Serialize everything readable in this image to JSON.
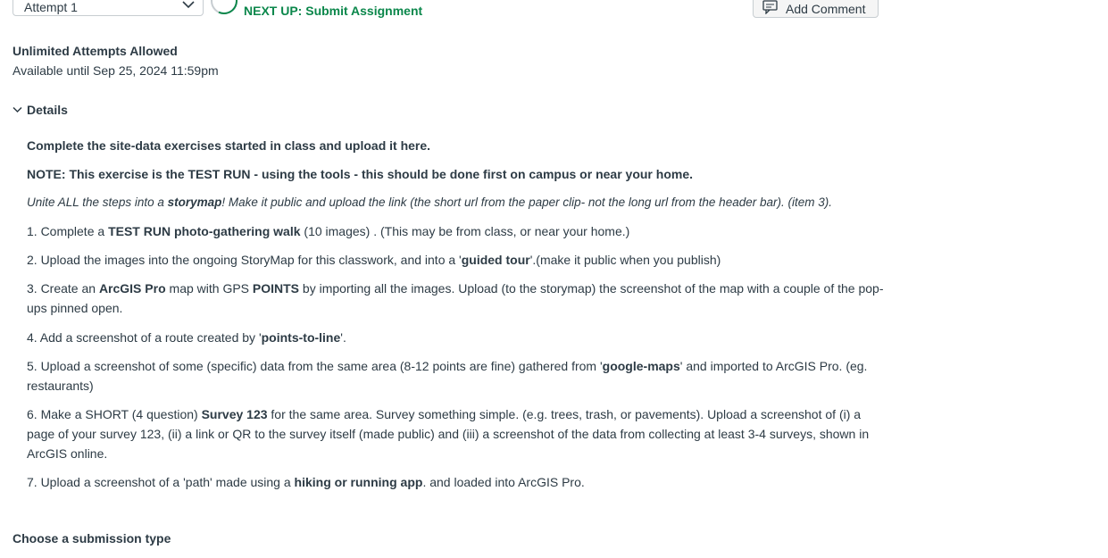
{
  "header": {
    "attempt_select": {
      "value": "Attempt 1"
    },
    "next_up": "NEXT UP: Submit Assignment",
    "add_comment_label": "Add Comment"
  },
  "assignment_meta": {
    "attempts": "Unlimited Attempts Allowed",
    "available_until": "Available until Sep 25, 2024 11:59pm"
  },
  "details": {
    "toggle_label": "Details",
    "intro": "Complete the site-data exercises started in class and upload it here.",
    "note": "NOTE: This exercise is the TEST RUN - using the tools - this should be done first on campus or near your home.",
    "storymap_note": {
      "a": "Unite ALL the steps into a ",
      "b": "storymap",
      "c": "!  Make it public and upload the link (the short url from the paper clip- not the long url from the header bar). (item 3)."
    },
    "steps": [
      {
        "a": "1. Complete a ",
        "b": "TEST RUN photo-gathering walk",
        "c": " (10 images) . (This may be from class, or near your home.)"
      },
      {
        "a": "2. Upload the images into the ongoing StoryMap for this classwork, and into a '",
        "b": "guided tour",
        "c": "'.(make it public when you publish)"
      },
      {
        "a": "3. Create an ",
        "b": "ArcGIS Pro",
        "c": " map with GPS ",
        "d": "POINTS",
        "e": " by importing all the images. Upload (to the storymap) the screenshot of the map with a couple of the pop-ups pinned open."
      },
      {
        "a": "4. Add a screenshot of a route created by '",
        "b": "points-to-line",
        "c": "'."
      },
      {
        "a": "5. Upload a screenshot of some (specific) data from the same area (8-12 points are fine) gathered from '",
        "b": "google-maps",
        "c": "' and imported to ArcGIS Pro. (eg. restaurants)"
      },
      {
        "a": "6. Make a SHORT (4 question) ",
        "b": "Survey 123",
        "c": " for the same area. Survey something simple. (e.g. trees, trash, or pavements). Upload a screenshot of (i) a page of your survey 123, (ii) a link or QR to the survey itself (made public) and (iii) a screenshot of the data from collecting at least 3-4 surveys, shown in ArcGIS online."
      },
      {
        "a": "7. Upload a screenshot of a 'path' made using a ",
        "b": "hiking or running app",
        "c": ". and loaded into ArcGIS Pro."
      }
    ]
  },
  "submission": {
    "heading": "Choose a submission type"
  },
  "colors": {
    "accent_green": "#0b874b",
    "text": "#2d3b45",
    "border": "#c7cdd1"
  },
  "icons": {
    "select": "chevron-down-icon",
    "comment": "comment-icon",
    "details": "chevron-down-icon"
  }
}
